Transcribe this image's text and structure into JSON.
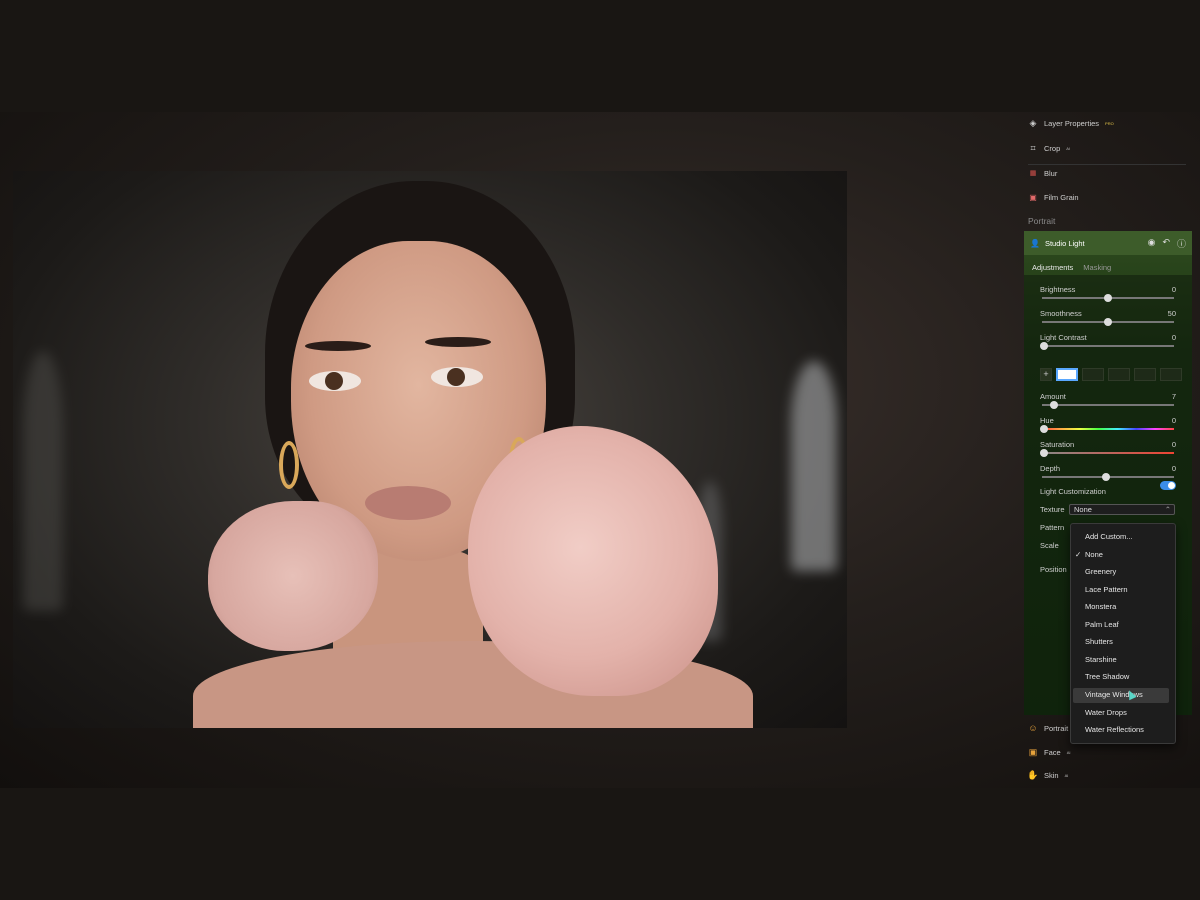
{
  "panel": {
    "tools": [
      {
        "label": "Layer Properties",
        "badge": "PRO",
        "icon": "layers-icon"
      },
      {
        "label": "Crop",
        "badge": "AI",
        "icon": "crop-icon"
      },
      {
        "label": "Blur",
        "icon": "blur-icon"
      },
      {
        "label": "Film Grain",
        "icon": "film-grain-icon"
      }
    ],
    "section_label": "Portrait",
    "studio_light": {
      "title": "Studio Light",
      "tabs": [
        "Adjustments",
        "Masking"
      ],
      "sliders": [
        {
          "label": "Brightness",
          "value": "0",
          "fraction": 0.5
        },
        {
          "label": "Smoothness",
          "value": "50",
          "fraction": 0.5
        },
        {
          "label": "Light Contrast",
          "value": "0",
          "fraction": 0.0
        }
      ],
      "sliders2": [
        {
          "label": "Amount",
          "value": "7",
          "fraction": 0.07
        },
        {
          "label": "Hue",
          "value": "0",
          "fraction": 0.0
        },
        {
          "label": "Saturation",
          "value": "0",
          "fraction": 0.0
        },
        {
          "label": "Depth",
          "value": "",
          "fraction": 0.5
        }
      ],
      "light_customization": "Light Customization",
      "texture_label": "Texture",
      "texture_value": "None",
      "pattern_label": "Pattern",
      "scale_label": "Scale",
      "position_label": "Position"
    },
    "bottom_tools": [
      {
        "label": "Portrait",
        "icon": "portrait-icon"
      },
      {
        "label": "Face",
        "badge": "AI",
        "icon": "face-icon"
      },
      {
        "label": "Skin",
        "badge": "AI",
        "icon": "skin-icon"
      }
    ]
  },
  "texture_menu": {
    "items": [
      "Add Custom...",
      "None",
      "Greenery",
      "Lace Pattern",
      "Monstera",
      "Palm Leaf",
      "Shutters",
      "Starshine",
      "Tree Shadow",
      "Vintage Windows",
      "Water Drops",
      "Water Reflections"
    ],
    "checked": "None",
    "highlighted": "Vintage Windows"
  }
}
